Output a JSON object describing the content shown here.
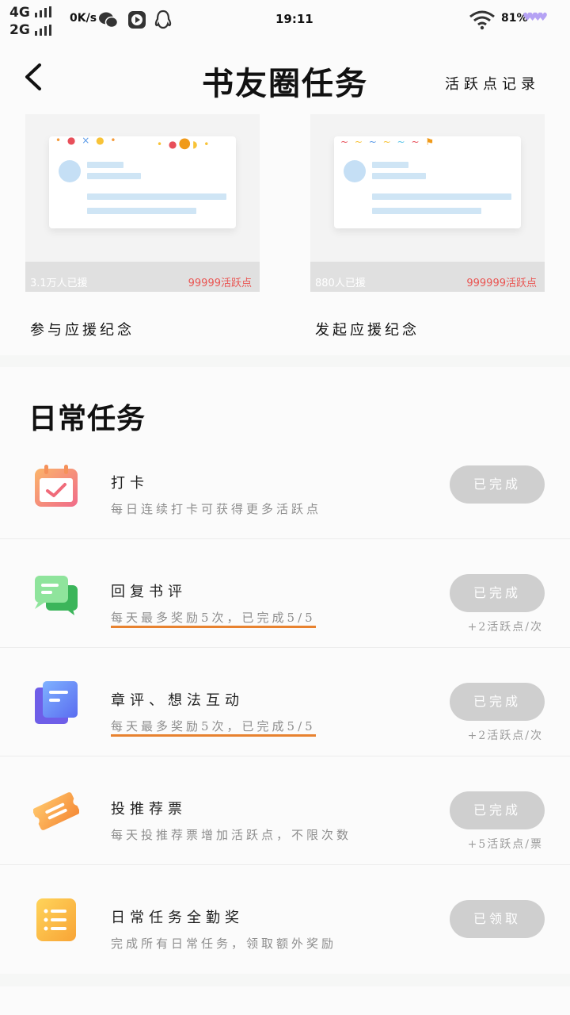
{
  "status_bar": {
    "network_1": "4G",
    "network_2": "2G",
    "speed": "0K/s",
    "time": "19:11",
    "battery": "81%",
    "icons": [
      "wechat-icon",
      "video-icon",
      "qq-icon",
      "wifi-icon",
      "hearts-icon"
    ]
  },
  "header": {
    "title": "书友圈任务",
    "records_label": "活跃点记录",
    "back_icon": "back-arrow-icon"
  },
  "cards": [
    {
      "participants": "3.1万人已援",
      "points": "99999活跃点",
      "label": "参与应援纪念"
    },
    {
      "participants": "880人已援",
      "points": "999999活跃点",
      "label": "发起应援纪念"
    }
  ],
  "daily": {
    "title": "日常任务",
    "tasks": [
      {
        "name": "打卡",
        "desc": "每日连续打卡可获得更多活跃点",
        "button": "已完成",
        "bonus": "",
        "icon": "calendar-check-icon",
        "color": "#f2766d"
      },
      {
        "name": "回复书评",
        "desc": "每天最多奖励5次，已完成5/5",
        "button": "已完成",
        "bonus": "+2活跃点/次",
        "icon": "chat-bubbles-icon",
        "color": "#4fcf69"
      },
      {
        "name": "章评、想法互动",
        "desc": "每天最多奖励5次，已完成5/5",
        "button": "已完成",
        "bonus": "+2活跃点/次",
        "icon": "note-cards-icon",
        "color": "#5c78f2"
      },
      {
        "name": "投推荐票",
        "desc": "每天投推荐票增加活跃点，不限次数",
        "button": "已完成",
        "bonus": "+5活跃点/票",
        "icon": "ticket-icon",
        "color": "#f8a744"
      },
      {
        "name": "日常任务全勤奖",
        "desc": "完成所有日常任务，领取额外奖励",
        "button": "已领取",
        "bonus": "",
        "icon": "list-icon",
        "color": "#f9c33a"
      }
    ]
  },
  "colors": {
    "accent_red": "#e95552",
    "highlight_underline": "#e8822f",
    "button_done": "#cfcfcf"
  }
}
